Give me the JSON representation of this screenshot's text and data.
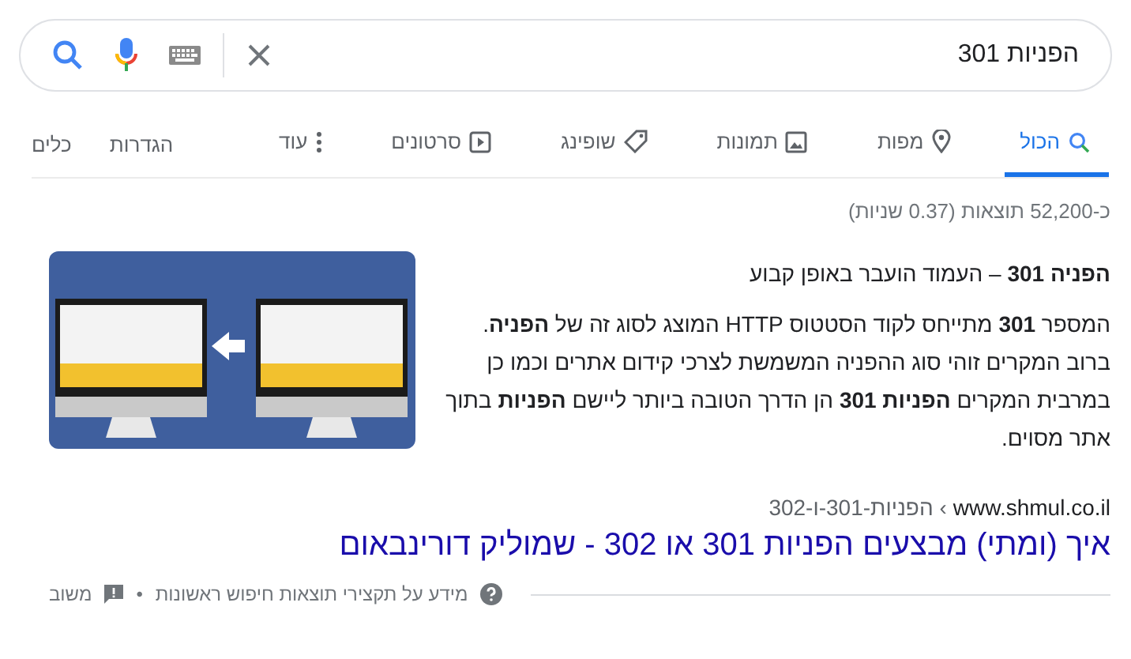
{
  "search": {
    "value": "הפניות 301"
  },
  "tabs": [
    {
      "label": "הכול",
      "selected": true
    },
    {
      "label": "מפות",
      "selected": false
    },
    {
      "label": "תמונות",
      "selected": false
    },
    {
      "label": "שופינג",
      "selected": false
    },
    {
      "label": "סרטונים",
      "selected": false
    },
    {
      "label": "עוד",
      "selected": false
    }
  ],
  "tools": [
    "הגדרות",
    "כלים"
  ],
  "result_stats": "כ-52,200 תוצאות (0.37 שניות)",
  "snippet": {
    "heading": "**הפניה 301** – העמוד הועבר באופן קבוע",
    "text": "המספר **301** מתייחס לקוד הסטטוס HTTP המוצג לסוג זה של **הפניה**. ברוב המקרים זוהי סוג ההפניה המשמשת לצרכי קידום אתרים וכמו כן במרבית המקרים **הפניות 301** הן הדרך הטובה ביותר ליישם **הפניות** בתוך אתר מסוים."
  },
  "result": {
    "site": "www.shmul.co.il",
    "path": "› הפניות-301-ו-302",
    "title": "איך (ומתי) מבצעים הפניות 301 או 302 - שמוליק דורינבאום"
  },
  "footer": {
    "about": "מידע על תקצירי תוצאות חיפוש ראשונות",
    "separator": "•",
    "feedback": "משוב"
  }
}
